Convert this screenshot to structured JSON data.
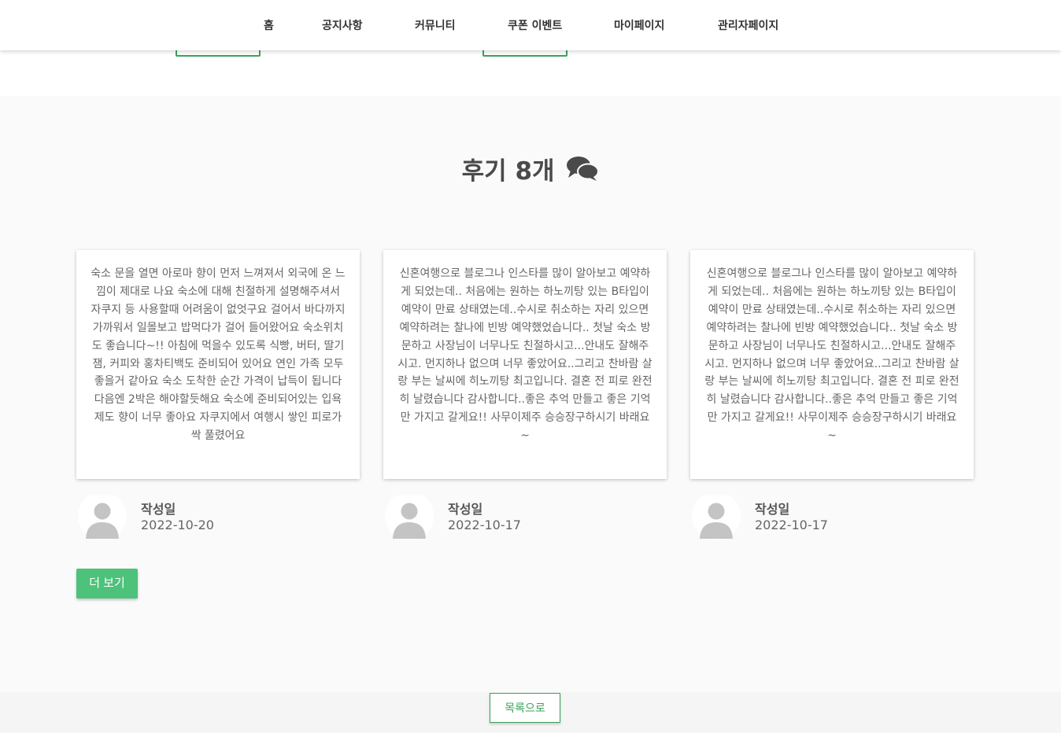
{
  "nav": {
    "items": [
      {
        "label": "홈"
      },
      {
        "label": "공지사항"
      },
      {
        "label": "커뮤니티"
      },
      {
        "label": "쿠폰 이벤트"
      },
      {
        "label": "마이페이지"
      },
      {
        "label": "관리자페이지"
      }
    ]
  },
  "reviews": {
    "title": "후기 8개",
    "title_icon": "comments-icon",
    "more_label": "더 보기",
    "items": [
      {
        "text": "숙소 문을 열면 아로마 향이 먼저 느껴져서 외국에 온 느낌이 제대로 나요 숙소에 대해 친절하게 설명해주셔서 자쿠지 등 사용할때 어려움이 없엇구요 걸어서 바다까지 가까워서 일몰보고 밥먹다가 걸어 들어왔어요 숙소위치도 좋습니다~!! 아침에 먹을수 있도록 식빵, 버터, 딸기잼, 커피와 홍차티백도 준비되어 있어요 연인 가족 모두 좋을거 같아요 숙소 도착한 순간 가격이 납득이 됩니다 다음엔 2박은 해야할듯해요 숙소에 준비되어있는 입욕제도 향이 너무 좋아요 자쿠지에서 여행시 쌓인 피로가 싹 풀렸어요",
        "author_label": "작성일",
        "date": "2022-10-20"
      },
      {
        "text": "신혼여행으로 블로그나 인스타를 많이 알아보고 예약하게 되었는데.. 처음에는 원하는 하노끼탕 있는 B타입이 예약이 만료 상태였는데..수시로 취소하는 자리 있으면 예약하려는 찰나에 빈방 예약했었습니다.. 첫날 숙소 방문하고 사장님이 너무나도 친절하시고...안내도 잘해주시고. 먼지하나 없으며 너무 좋았어요..그리고 찬바람 살랑 부는 날씨에 히노끼탕 최고입니다. 결혼 전 피로 완전히 날렸습니다 감사합니다..좋은 추억 만들고 좋은 기억만 가지고 갈게요!! 사무이제주 승승장구하시기 바래요~",
        "author_label": "작성일",
        "date": "2022-10-17"
      },
      {
        "text": "신혼여행으로 블로그나 인스타를 많이 알아보고 예약하게 되었는데.. 처음에는 원하는 하노끼탕 있는 B타입이 예약이 만료 상태였는데..수시로 취소하는 자리 있으면 예약하려는 찰나에 빈방 예약했었습니다.. 첫날 숙소 방문하고 사장님이 너무나도 친절하시고...안내도 잘해주시고. 먼지하나 없으며 너무 좋았어요..그리고 찬바람 살랑 부는 날씨에 히노끼탕 최고입니다. 결혼 전 피로 완전히 날렸습니다 감사합니다..좋은 추억 만들고 좋은 기억만 가지고 갈게요!! 사무이제주 승승장구하시기 바래요~",
        "author_label": "작성일",
        "date": "2022-10-17"
      }
    ]
  },
  "footer": {
    "back_label": "목록으로"
  },
  "colors": {
    "accent": "#4cc27a",
    "accent_dark": "#3aa35a",
    "background": "#fafafa"
  }
}
